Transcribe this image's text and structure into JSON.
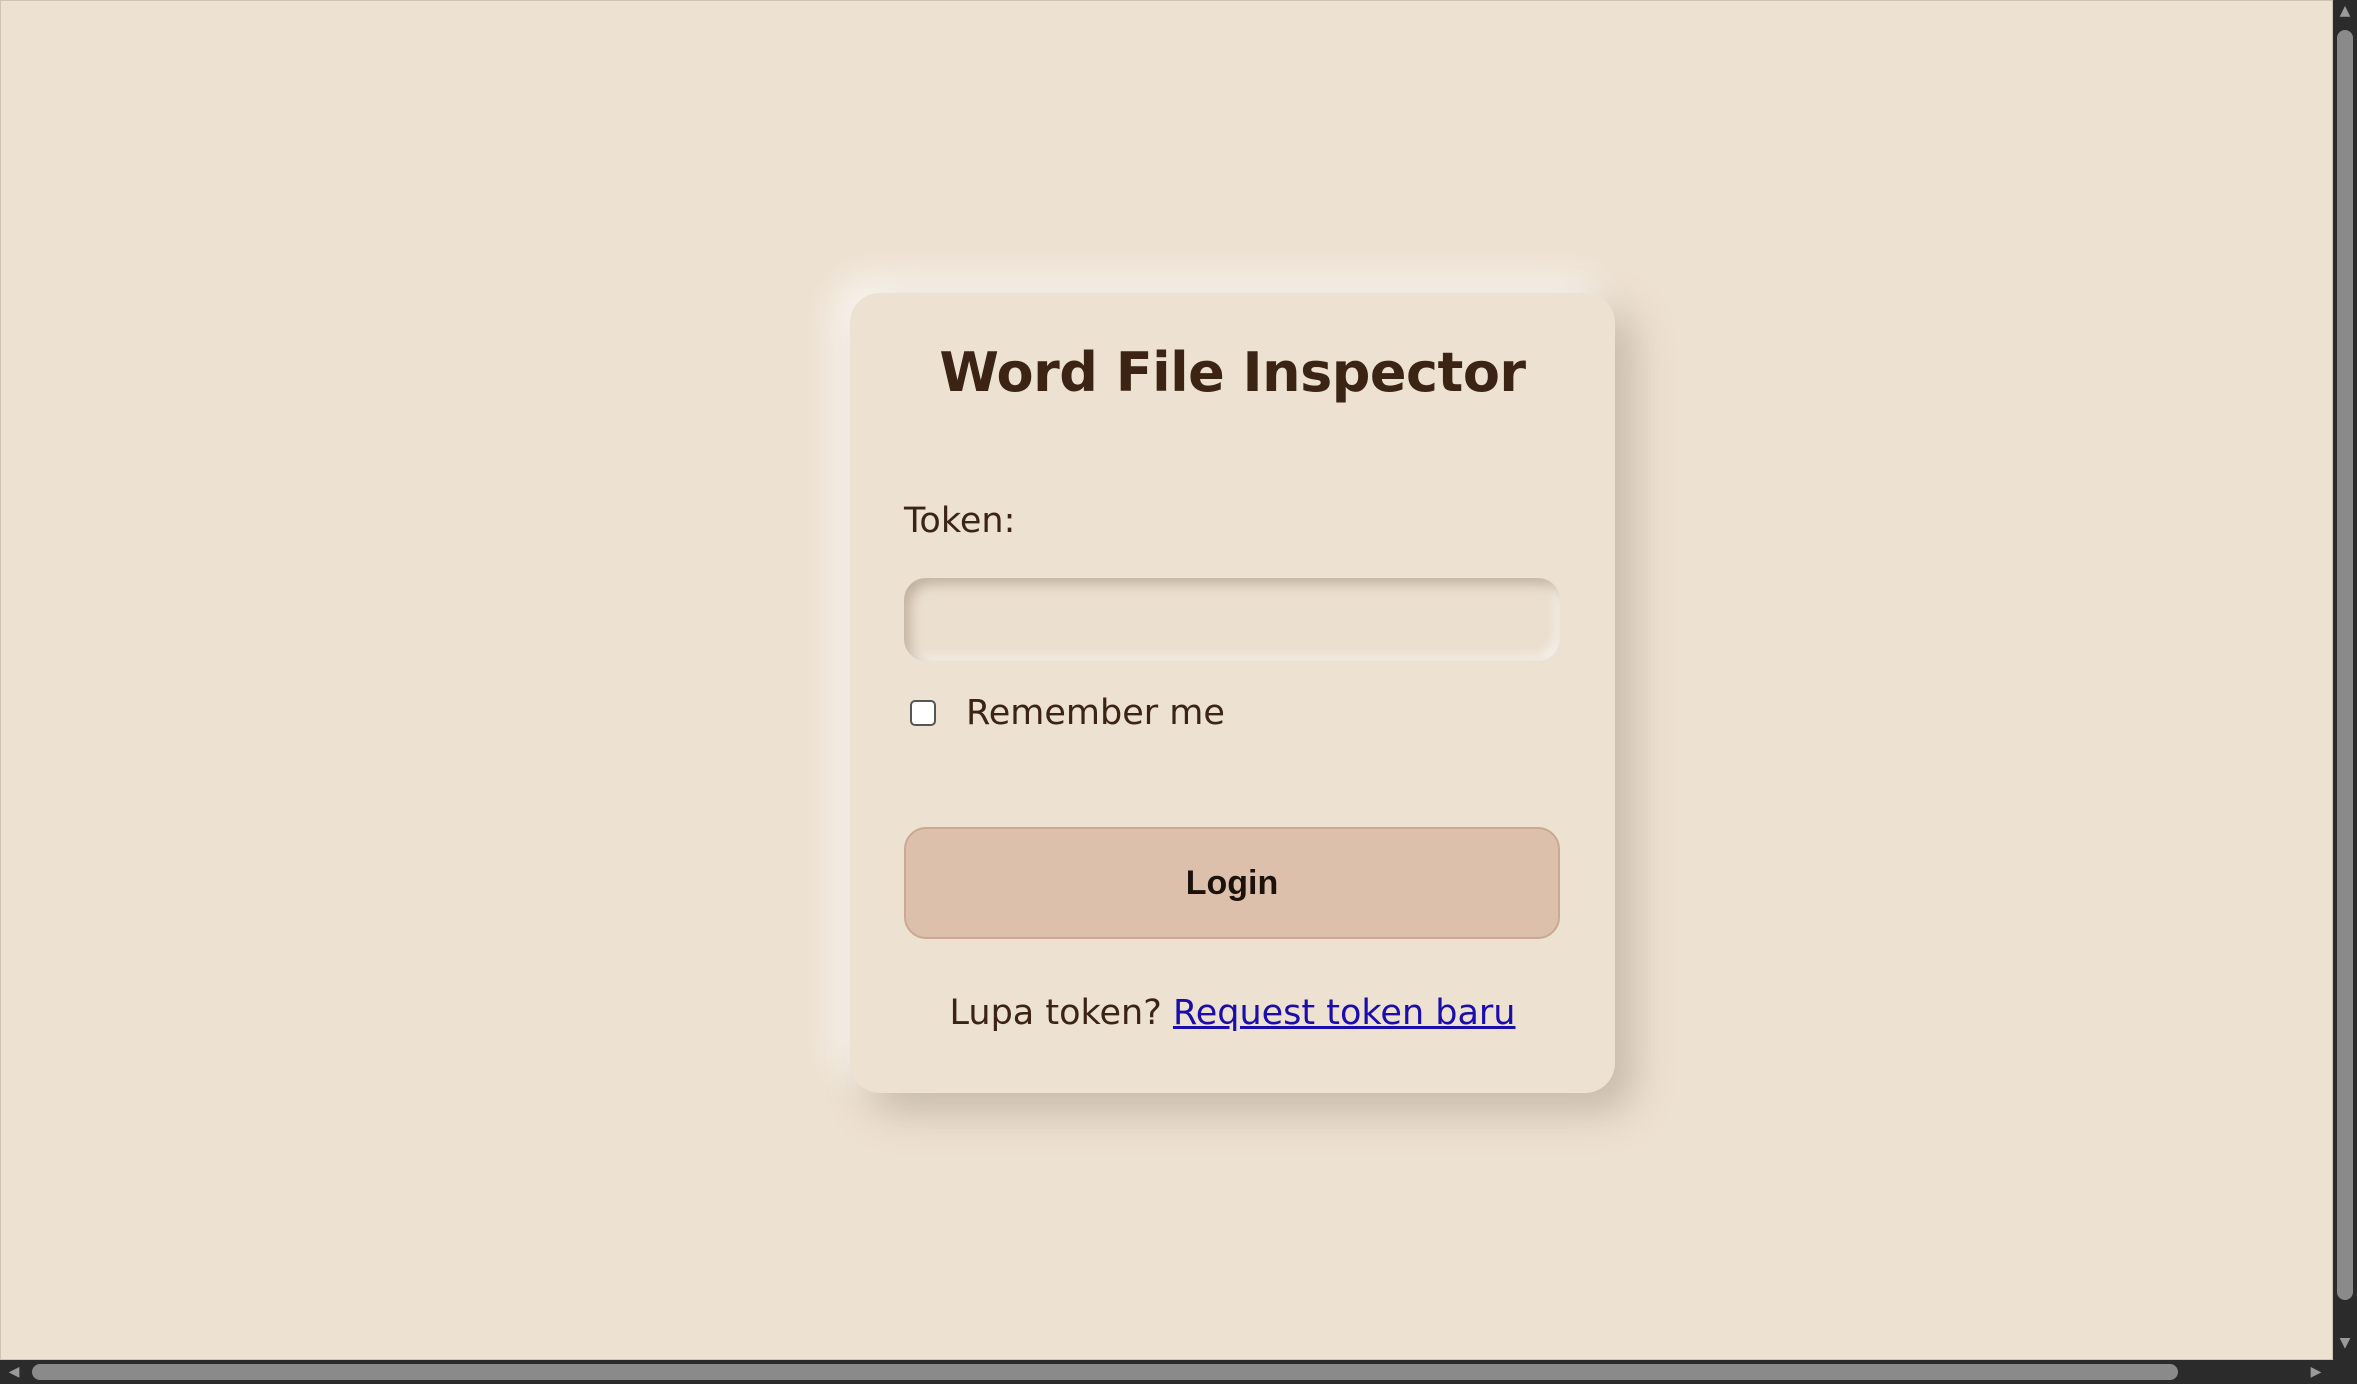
{
  "app": {
    "title": "Word File Inspector"
  },
  "form": {
    "token_label": "Token:",
    "token_value": "",
    "token_placeholder": "",
    "remember_label": "Remember me",
    "remember_checked": false,
    "login_label": "Login"
  },
  "footer": {
    "prompt": "Lupa token?",
    "link_text": "Request token baru"
  },
  "colors": {
    "background": "#ede1d1",
    "text": "#3b2414",
    "button": "#dcc0ab",
    "link": "#1a0dab"
  },
  "icons": {
    "scroll_up": "triangle-up",
    "scroll_down": "triangle-down",
    "scroll_left": "triangle-left",
    "scroll_right": "triangle-right"
  }
}
